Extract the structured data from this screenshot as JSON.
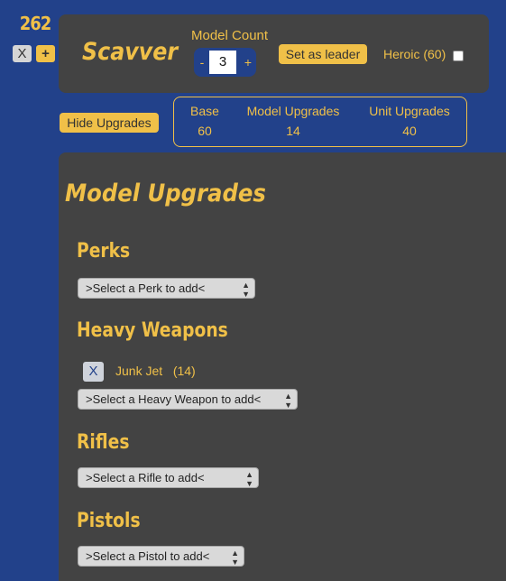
{
  "points_total": "262",
  "controls": {
    "remove_label": "X",
    "add_label": "+"
  },
  "unit": {
    "name": "Scavver",
    "model_count_label": "Model Count",
    "model_count_value": "3",
    "minus_label": "-",
    "plus_label": "+",
    "leader_button": "Set as leader",
    "heroic_label": "Heroic (60)",
    "heroic_checked": false
  },
  "toggle_upgrades": "Hide Upgrades",
  "summary": [
    {
      "label": "Base",
      "value": "60"
    },
    {
      "label": "Model Upgrades",
      "value": "14"
    },
    {
      "label": "Unit Upgrades",
      "value": "40"
    }
  ],
  "panel": {
    "title": "Model Upgrades",
    "sections": [
      {
        "title": "Perks",
        "select_placeholder": ">Select a Perk to add<",
        "items": []
      },
      {
        "title": "Heavy Weapons",
        "select_placeholder": ">Select a Heavy Weapon to add<",
        "items": [
          {
            "remove": "X",
            "name": "Junk Jet",
            "cost": "(14)"
          }
        ]
      },
      {
        "title": "Rifles",
        "select_placeholder": ">Select a Rifle to add<",
        "items": []
      },
      {
        "title": "Pistols",
        "select_placeholder": ">Select a Pistol to add<",
        "items": []
      }
    ]
  },
  "colors": {
    "background": "#22418a",
    "card": "#434343",
    "accent": "#f0c048"
  }
}
